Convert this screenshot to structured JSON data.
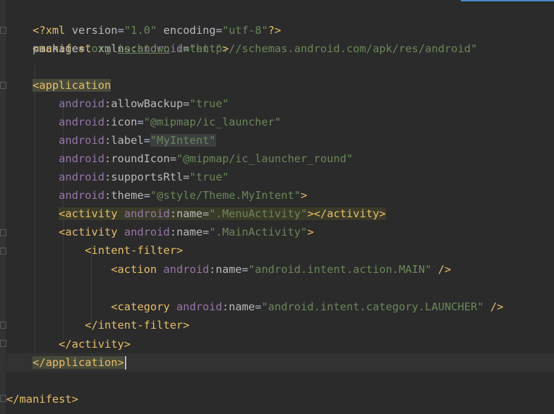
{
  "editor": {
    "lines": {
      "l1": {
        "p1": "<?xml ",
        "a1": "version",
        "p2": "=",
        "s1": "\"1.0\"",
        "p3": " ",
        "a2": "encoding",
        "p4": "=",
        "s2": "\"utf-8\"",
        "p5": "?>"
      },
      "l2": {
        "t1": "<manifest ",
        "a1": "xmlns:",
        "n1": "android",
        "p1": "=",
        "s1": "\"http://schemas.android.com/apk/res/android\""
      },
      "l3": {
        "a1": "package",
        "p1": "=",
        "s1": "\"org.",
        "s2": "techtown",
        "s3": ".intent\"",
        "t1": ">"
      },
      "l5": {
        "t1": "<application"
      },
      "l6": {
        "n1": "android",
        "a1": ":allowBackup",
        "p1": "=",
        "s1": "\"true\""
      },
      "l7": {
        "n1": "android",
        "a1": ":icon",
        "p1": "=",
        "s1": "\"@mipmap/ic_launcher\""
      },
      "l8": {
        "n1": "android",
        "a1": ":label",
        "p1": "=",
        "s1": "\"MyIntent\""
      },
      "l9": {
        "n1": "android",
        "a1": ":roundIcon",
        "p1": "=",
        "s1": "\"@mipmap/ic_launcher_round\""
      },
      "l10": {
        "n1": "android",
        "a1": ":supportsRtl",
        "p1": "=",
        "s1": "\"true\""
      },
      "l11": {
        "n1": "android",
        "a1": ":theme",
        "p1": "=",
        "s1": "\"@style/Theme.MyIntent\"",
        "t1": ">"
      },
      "l12": {
        "t1": "<activity ",
        "n1": "android",
        "a1": ":name",
        "p1": "=",
        "s1": "\".MenuActivity\"",
        "t2": "></activity>"
      },
      "l13": {
        "t1": "<activity ",
        "n1": "android",
        "a1": ":name",
        "p1": "=",
        "s1": "\".MainActivity\"",
        "t2": ">"
      },
      "l14": {
        "t1": "<intent-filter>"
      },
      "l15": {
        "t1": "<action ",
        "n1": "android",
        "a1": ":name",
        "p1": "=",
        "s1": "\"android.intent.action.MAIN\"",
        "t2": " />"
      },
      "l17": {
        "t1": "<category ",
        "n1": "android",
        "a1": ":name",
        "p1": "=",
        "s1": "\"android.intent.category.LAUNCHER\"",
        "t2": " />"
      },
      "l18": {
        "t1": "</intent-filter>"
      },
      "l19": {
        "t1": "</activity>"
      },
      "l20": {
        "t1": "</application>"
      },
      "l22": {
        "t1": "</manifest>"
      }
    }
  },
  "gutter": {
    "intention_icon": "lightbulb-icon"
  },
  "colors": {
    "background": "#2b2b2b",
    "tag": "#e8bf6a",
    "namespace": "#9876aa",
    "attribute": "#bababa",
    "string": "#6a8759",
    "default": "#a9b7c6",
    "accent": "#4a88c7"
  }
}
